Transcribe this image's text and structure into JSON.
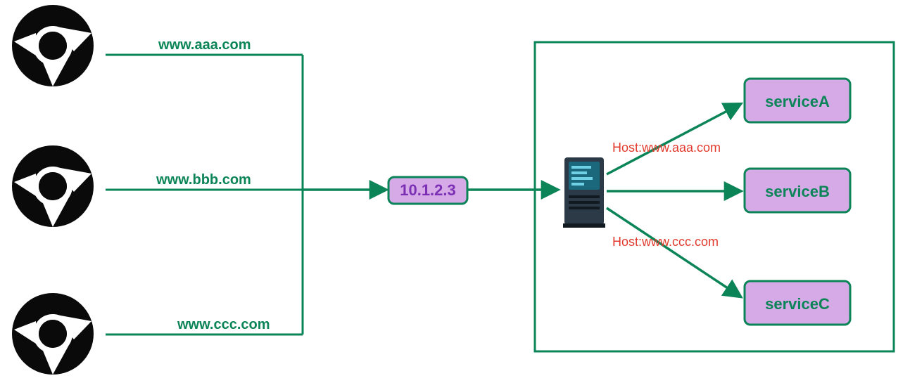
{
  "browsers": [
    {
      "domain": "www.aaa.com"
    },
    {
      "domain": "www.bbb.com"
    },
    {
      "domain": "www.ccc.com"
    }
  ],
  "ip": "10.1.2.3",
  "services": [
    {
      "name": "serviceA"
    },
    {
      "name": "serviceB"
    },
    {
      "name": "serviceC"
    }
  ],
  "hostLabels": [
    "Host:www.aaa.com",
    "Host:www.ccc.com"
  ],
  "colors": {
    "green": "#0b8457",
    "purple": "#d6aae6",
    "purpleStroke": "#7b2fb5",
    "red": "#e23b2e",
    "black": "#0a0a0a"
  }
}
